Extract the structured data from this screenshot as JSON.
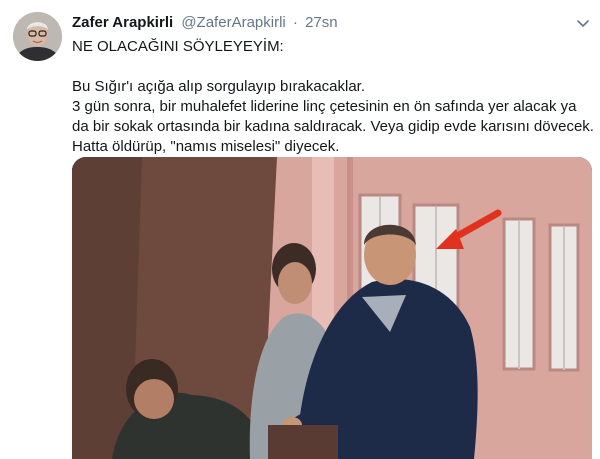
{
  "tweet": {
    "author_name": "Zafer Arapkirli",
    "handle": "@ZaferArapkirli",
    "separator": "·",
    "time": "27sn",
    "lines": [
      "NE OLACAĞINI SÖYLEYEYİM:",
      "Bu Sığır'ı açığa alıp sorgulayıp bırakacaklar.",
      "3 gün sonra, bir muhalefet liderine linç çetesinin en ön safında yer alacak ya da bir sokak ortasında bir kadına saldıracak. Veya gidip evde karısını dövecek.",
      "Hatta öldürüp, \"namıs miselesi\" diyecek."
    ]
  },
  "icons": {
    "menu": "chevron-down-icon",
    "annotation": "red-arrow-icon"
  },
  "colors": {
    "text": "#14171a",
    "secondary": "#657786",
    "arrow": "#e0321f"
  }
}
